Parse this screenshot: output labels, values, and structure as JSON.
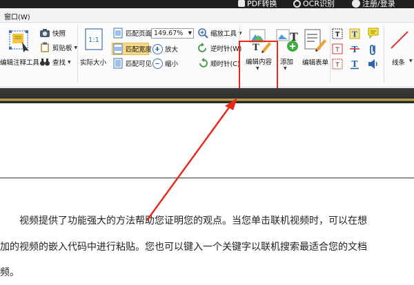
{
  "topbar": {
    "pdf_convert": "PDF转换",
    "ocr": "OCR识别",
    "register_login": "注册/登录"
  },
  "menubar": {
    "window_menu": "窗口(W)"
  },
  "ribbon": {
    "annot_tool_label": "编辑注释工具",
    "snapshot_label": "快照",
    "clipboard_label": "剪贴板",
    "find_label": "查找",
    "actual_size_label": "实际大小",
    "fit_page_label": "匹配页面",
    "fit_width_label": "匹配宽度",
    "fit_visible_label": "匹配可见",
    "zoom_value": "149.67%",
    "zoom_tool_label": "缩放工具",
    "zoom_in_label": "放大",
    "zoom_out_label": "缩小",
    "rotate_ccw_label": "逆时针(W)",
    "rotate_cw_label": "顺时针(C)",
    "edit_content_label": "编辑内容",
    "add_label": "添加",
    "edit_form_label": "编辑表单",
    "line_label": "线条"
  },
  "colors": {
    "highlight": "#e8281f",
    "selected": "#f7d98a"
  },
  "document": {
    "line1": "视频提供了功能强大的方法帮助您证明您的观点。当您单击联机视频时，可以在想",
    "line2": "加的视频的嵌入代码中进行粘贴。您也可以键入一个关键字以联机搜索最适合您的文档",
    "line3": "频。"
  }
}
